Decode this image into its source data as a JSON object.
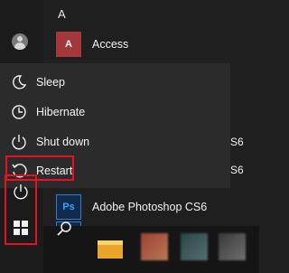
{
  "start_menu": {
    "section_letter": "A",
    "apps": [
      {
        "label": "Access",
        "icon": "access-icon",
        "tile": "A"
      },
      {
        "label": "Adobe Photoshop CS6",
        "icon": "photoshop-icon",
        "tile": "Ps"
      },
      {
        "label": "",
        "icon": "photoshop-icon",
        "tile": "Ps"
      }
    ],
    "partial_text": [
      "S6",
      "S6"
    ]
  },
  "power_menu": {
    "items": [
      {
        "label": "Sleep",
        "icon": "moon-icon"
      },
      {
        "label": "Hibernate",
        "icon": "clock-icon"
      },
      {
        "label": "Shut down",
        "icon": "power-icon"
      },
      {
        "label": "Restart",
        "icon": "restart-icon"
      }
    ]
  },
  "colors": {
    "highlight": "#e81123",
    "menu_bg": "#2b2b2b",
    "access": "#a4373a",
    "photoshop": "#31a8ff"
  }
}
